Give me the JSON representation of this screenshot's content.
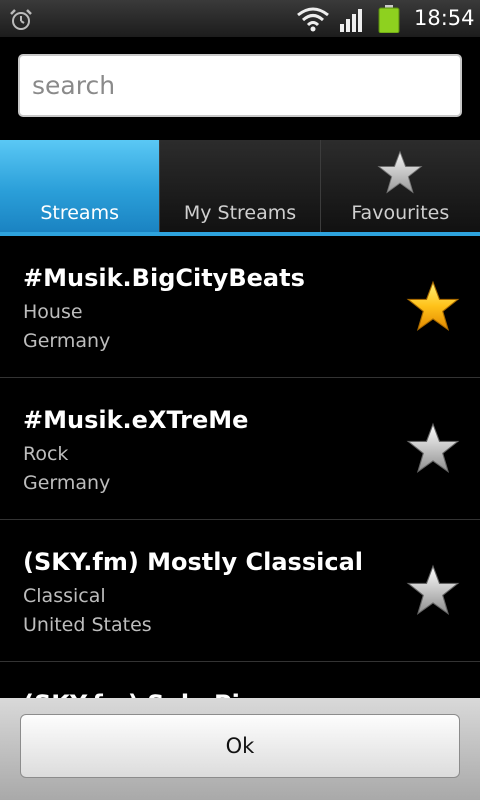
{
  "status_bar": {
    "time": "18:54",
    "icons": [
      "alarm-clock-icon",
      "wifi-icon",
      "signal-icon",
      "battery-icon"
    ],
    "battery_color": "#8ed11f"
  },
  "search": {
    "placeholder": "search",
    "value": ""
  },
  "tabs": [
    {
      "label": "Streams",
      "active": true,
      "icon": null
    },
    {
      "label": "My Streams",
      "active": false,
      "icon": null
    },
    {
      "label": "Favourites",
      "active": false,
      "icon": "star-icon"
    }
  ],
  "accent_color": "#2ea3dd",
  "streams": [
    {
      "title": "#Musik.BigCityBeats",
      "genre": "House",
      "country": "Germany",
      "favourite": true
    },
    {
      "title": "#Musik.eXTreMe",
      "genre": "Rock",
      "country": "Germany",
      "favourite": false
    },
    {
      "title": "(SKY.fm) Mostly Classical",
      "genre": "Classical",
      "country": "United States",
      "favourite": false
    },
    {
      "title": "(SKY.fm) Solo Piano",
      "genre": "",
      "country": "",
      "favourite": false
    }
  ],
  "ok_button": {
    "label": "Ok"
  }
}
